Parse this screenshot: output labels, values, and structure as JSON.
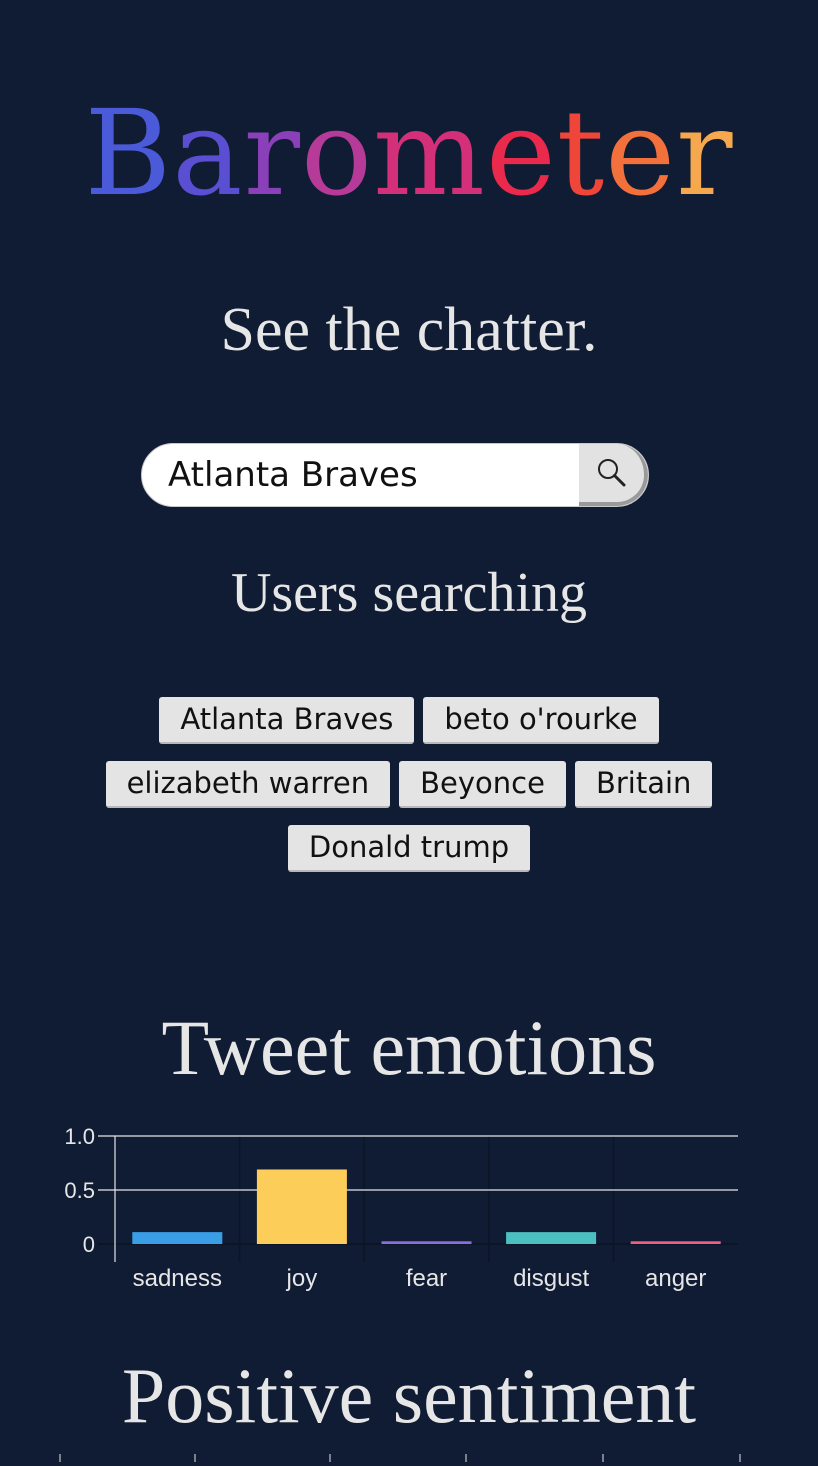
{
  "app": {
    "logo_letters": [
      {
        "char": "B",
        "color": "#4a5ad8"
      },
      {
        "char": "a",
        "color": "#5a4ed2"
      },
      {
        "char": "r",
        "color": "#8a40b8"
      },
      {
        "char": "o",
        "color": "#b63a98"
      },
      {
        "char": "m",
        "color": "#d4307a"
      },
      {
        "char": "e",
        "color": "#ea2a4c"
      },
      {
        "char": "t",
        "color": "#f0463a"
      },
      {
        "char": "e",
        "color": "#f2703c"
      },
      {
        "char": "r",
        "color": "#f6a84e"
      }
    ],
    "tagline": "See the chatter."
  },
  "search": {
    "value": "Atlanta Braves",
    "button_icon": "search-icon"
  },
  "users_searching": {
    "title": "Users searching",
    "items": [
      "Atlanta Braves",
      "beto o'rourke",
      "elizabeth warren",
      "Beyonce",
      "Britain",
      "Donald trump"
    ]
  },
  "emotions": {
    "title": "Tweet emotions"
  },
  "positive": {
    "title": "Positive sentiment"
  },
  "chart_data": {
    "type": "bar",
    "title": "Tweet emotions",
    "categories": [
      "sadness",
      "joy",
      "fear",
      "disgust",
      "anger"
    ],
    "values": [
      0.11,
      0.69,
      0.025,
      0.11,
      0.025
    ],
    "colors": [
      "#3a9ee6",
      "#fdcd5a",
      "#8a6ee0",
      "#4cc0c0",
      "#f06080"
    ],
    "yticks": [
      "0",
      "0.5",
      "1.0"
    ],
    "ytick_values": [
      0,
      0.5,
      1.0
    ],
    "ylim": [
      0,
      1.0
    ],
    "grid": true
  }
}
